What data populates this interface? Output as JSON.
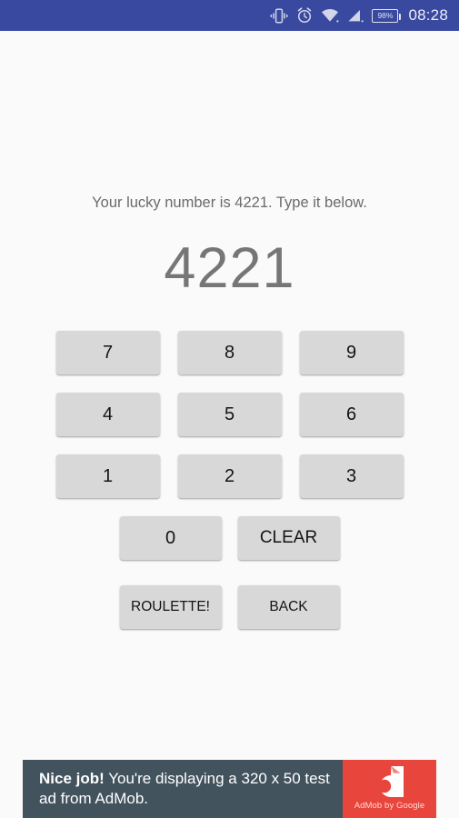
{
  "statusbar": {
    "time": "08:28",
    "battery_percent": "98%",
    "icons": [
      "vibrate-icon",
      "alarm-icon",
      "wifi-icon",
      "signal-icon",
      "battery-icon"
    ],
    "background_color": "#3949a0"
  },
  "main": {
    "prompt": "Your lucky number is 4221. Type it below.",
    "entered_number": "4221",
    "keypad": {
      "row1": [
        "7",
        "8",
        "9"
      ],
      "row2": [
        "4",
        "5",
        "6"
      ],
      "row3": [
        "1",
        "2",
        "3"
      ],
      "row4": [
        "0",
        "CLEAR"
      ]
    },
    "actions": {
      "primary": "ROULETTE!",
      "secondary": "BACK"
    },
    "colors": {
      "background": "#fafafa",
      "button": "#d8d8d8",
      "button_text": "#141414",
      "prompt_text": "#6b6b6b",
      "number_text": "#767676"
    }
  },
  "ad": {
    "headline": "Nice job!",
    "body": " You're displaying a 320 x 50 test ad from AdMob.",
    "logo_caption": "AdMob by Google",
    "colors": {
      "panel": "#43535e",
      "logo": "#e8453c"
    }
  }
}
